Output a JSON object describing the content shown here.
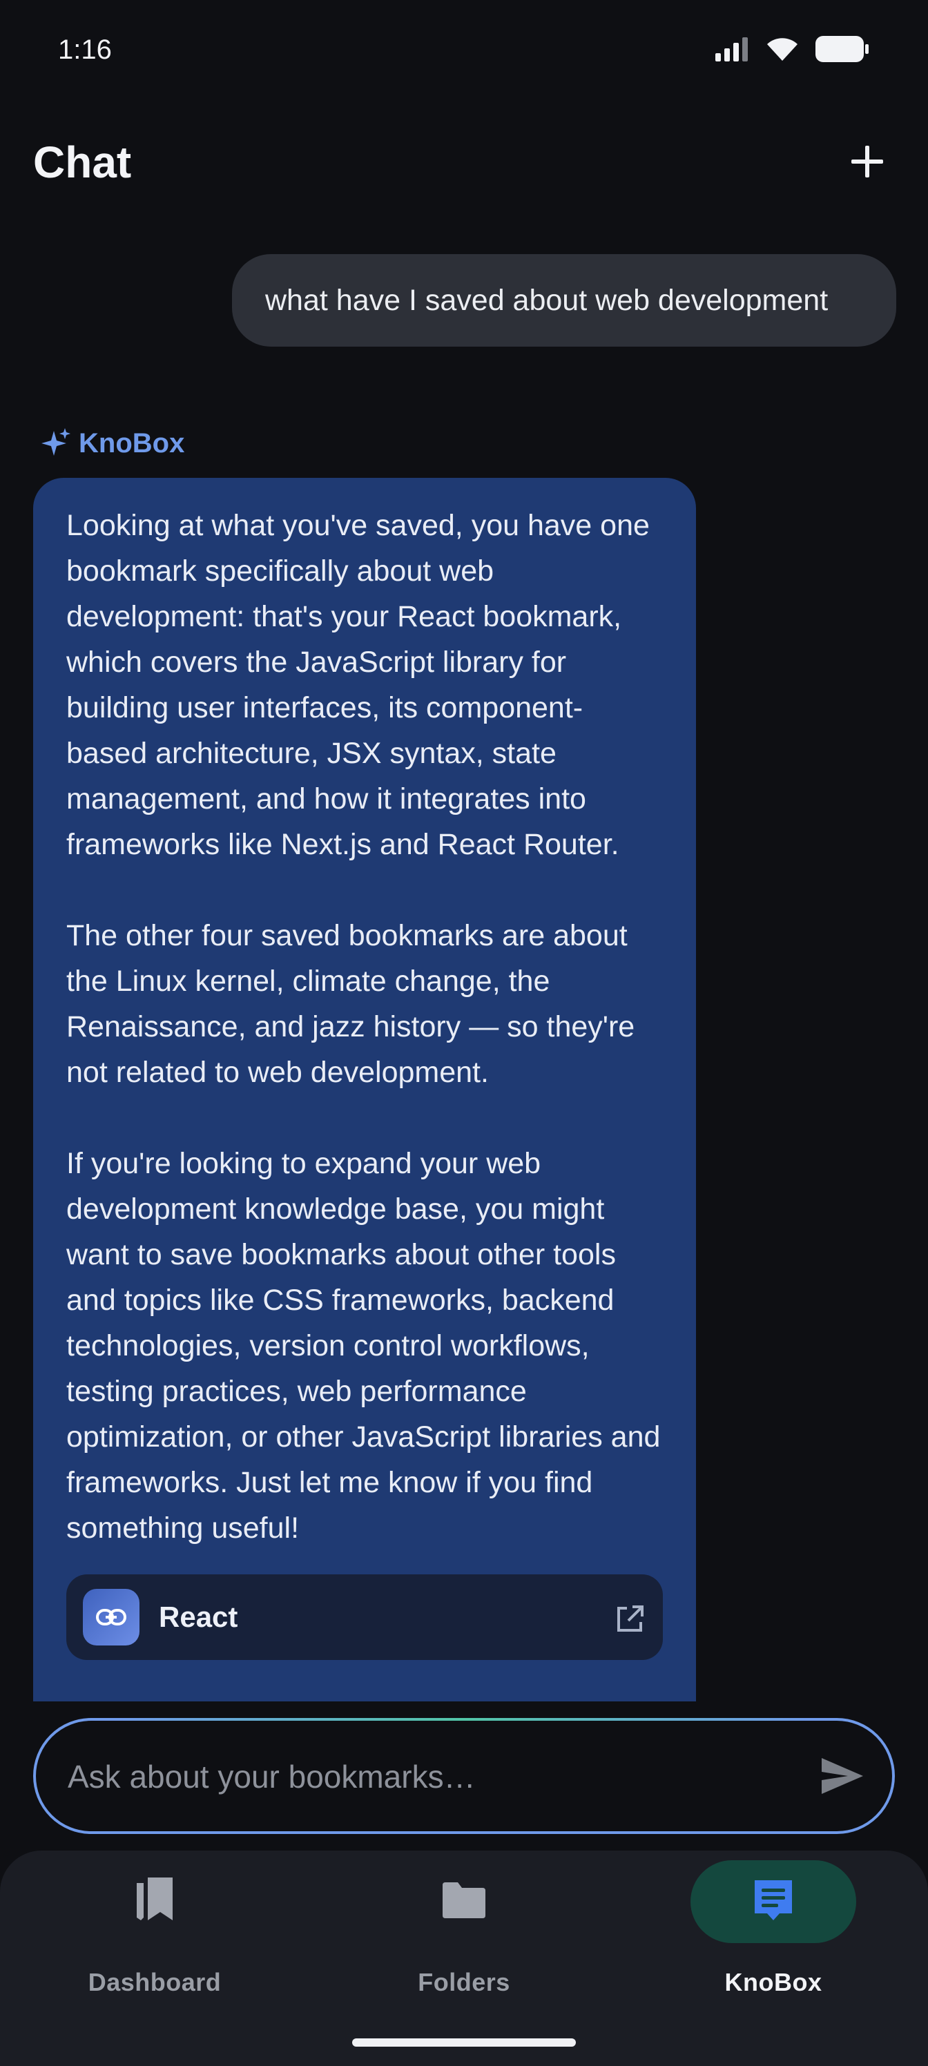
{
  "status_bar": {
    "time": "1:16",
    "icons": [
      "signal-icon",
      "wifi-icon",
      "battery-icon"
    ]
  },
  "header": {
    "title": "Chat",
    "new_chat_icon": "plus-icon"
  },
  "conversation": {
    "user_message": "what have I saved about web development",
    "assistant": {
      "name": "KnoBox",
      "icon": "sparkle-icon",
      "paragraphs": [
        "Looking at what you've saved, you have one bookmark specifically about web development: that's your React bookmark, which covers the JavaScript library for building user interfaces, its component-based architecture, JSX syntax, state management, and how it integrates into frameworks like Next.js and React Router.",
        "The other four saved bookmarks are about the Linux kernel, climate change, the Renaissance, and jazz history — so they're not related to web development.",
        "If you're looking to expand your web development knowledge base, you might want to save bookmarks about other tools and topics like CSS frameworks, backend technologies, version control workflows, testing practices, web performance optimization, or other JavaScript libraries and frameworks. Just let me know if you find something useful!"
      ],
      "source": {
        "title": "React",
        "icon": "link-icon",
        "action_icon": "open-external-icon"
      }
    }
  },
  "input": {
    "placeholder": "Ask about your bookmarks…",
    "value": "",
    "send_icon": "send-icon"
  },
  "bottom_nav": {
    "items": [
      {
        "label": "Dashboard",
        "icon": "bookmarks-icon",
        "active": false
      },
      {
        "label": "Folders",
        "icon": "folder-icon",
        "active": false
      },
      {
        "label": "KnoBox",
        "icon": "knobox-icon",
        "active": true
      }
    ]
  },
  "colors": {
    "background": "#0e0f13",
    "user_bubble": "#2d3038",
    "assistant_bubble": "#1f3a73",
    "accent": "#6f9aea",
    "active_nav": "#14483e"
  }
}
